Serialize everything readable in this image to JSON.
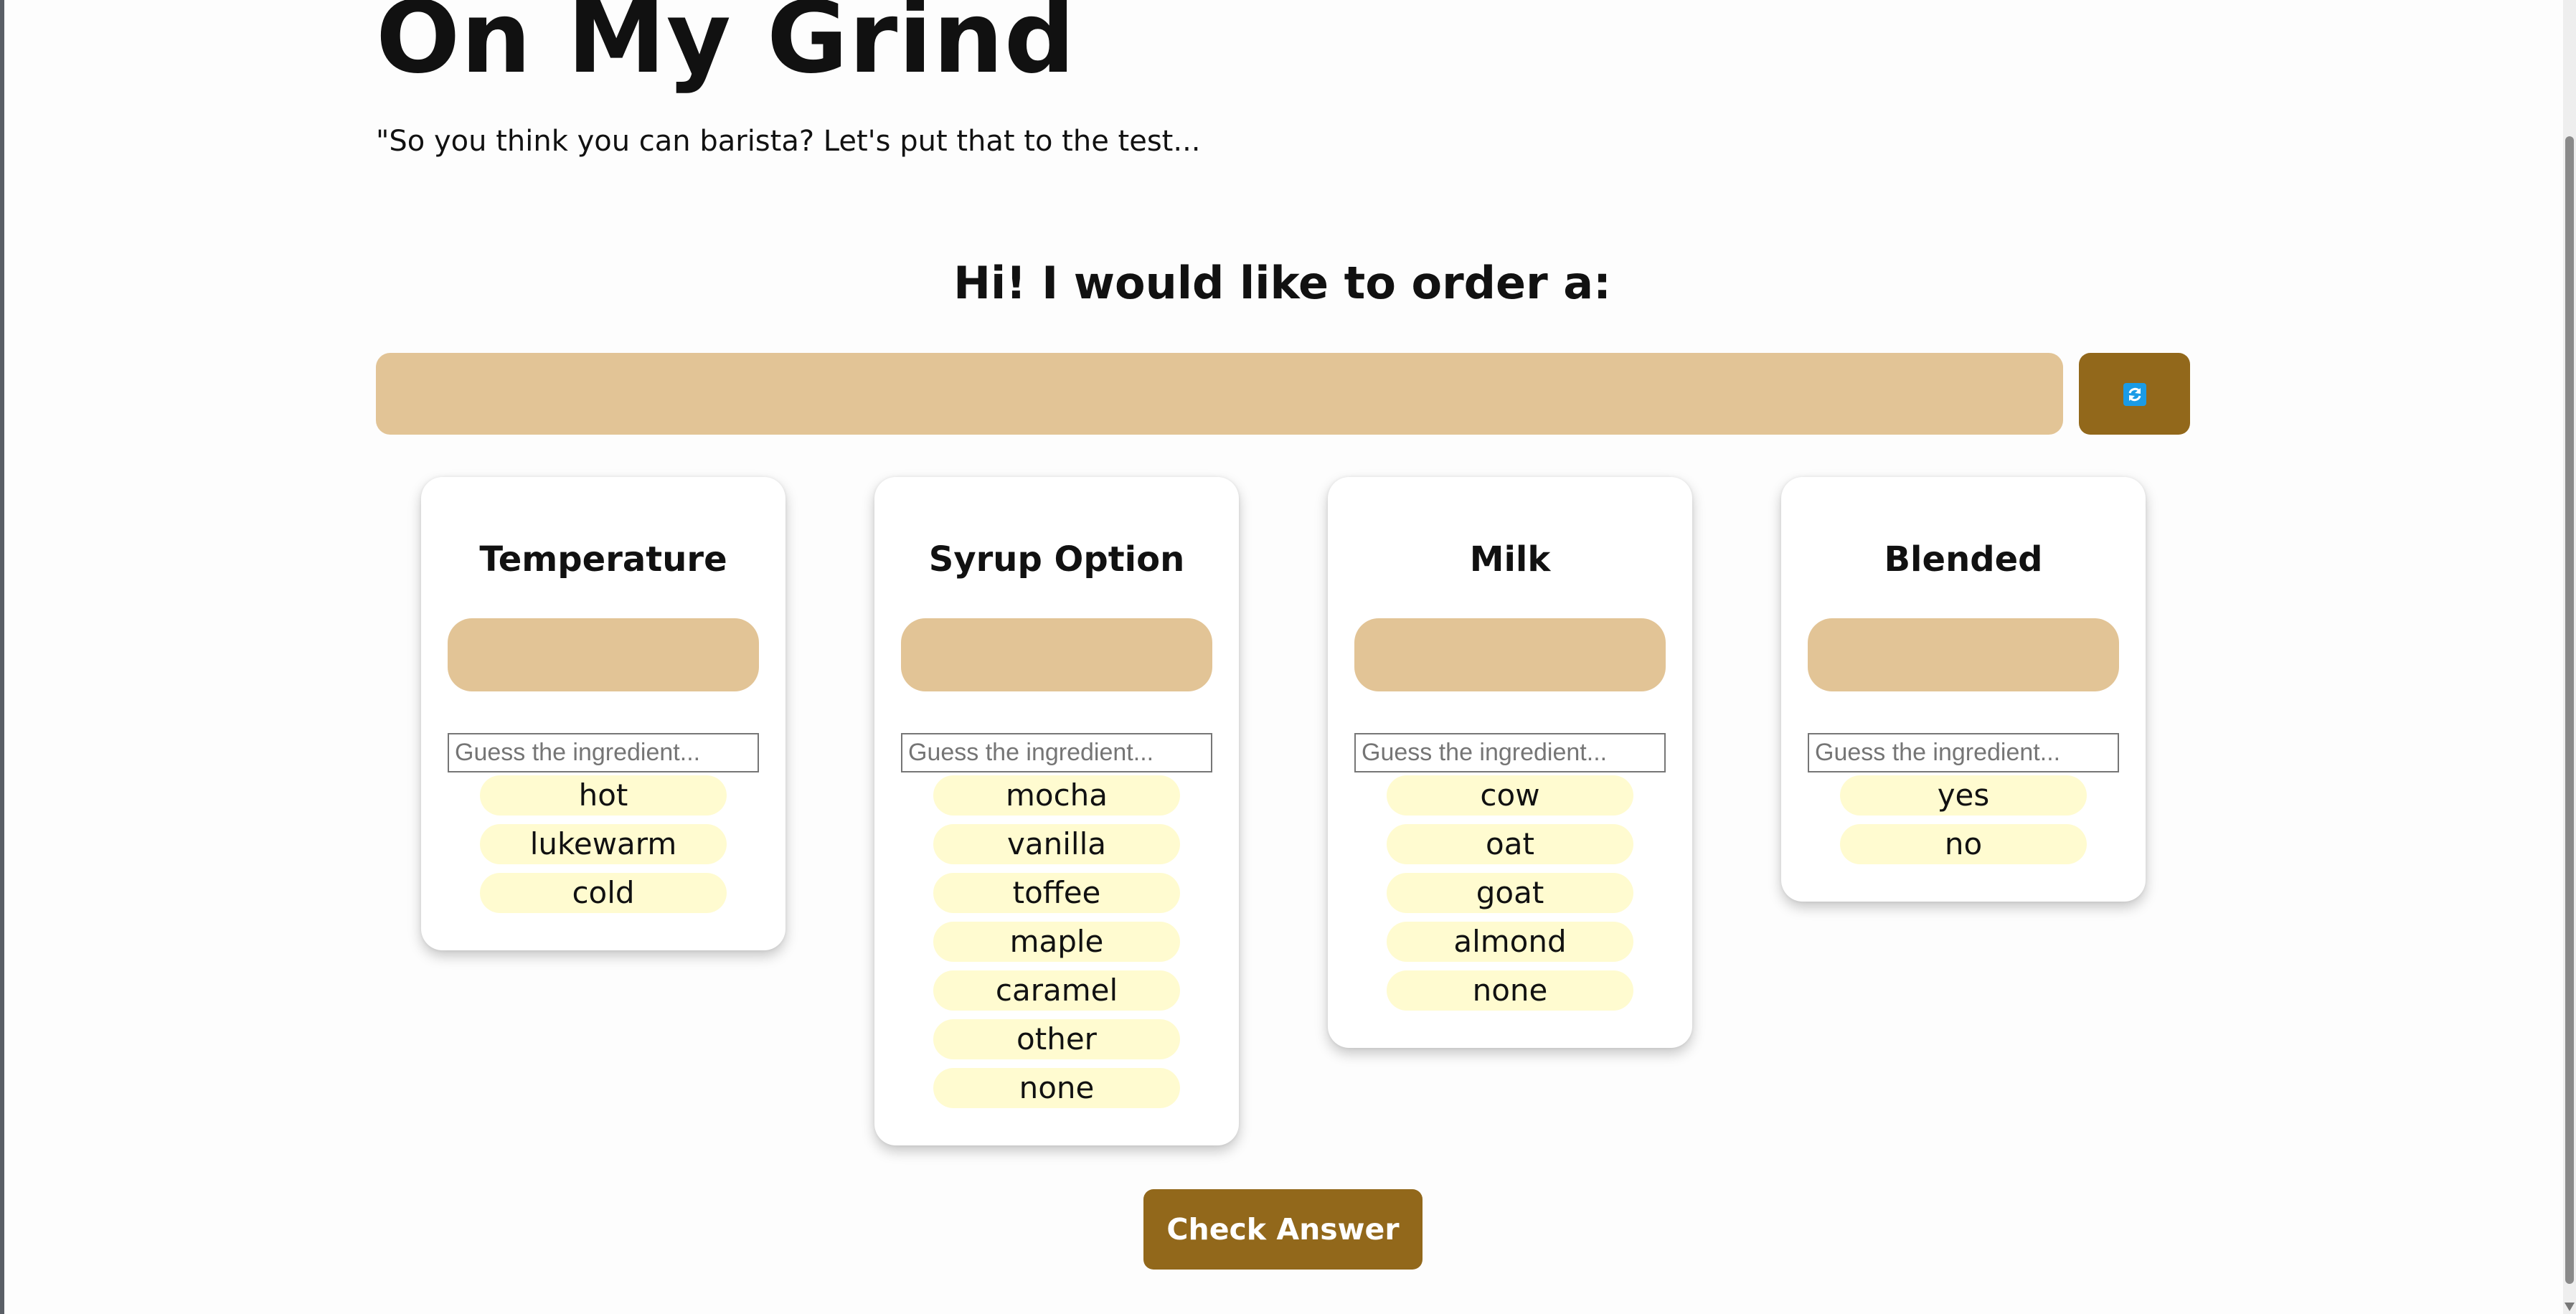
{
  "app": {
    "title": "On My Grind",
    "subtitle": "\"So you think you can barista? Let's put that to the test..."
  },
  "order": {
    "heading": "Hi! I would like to order a:",
    "current_order": "",
    "refresh_icon": "refresh-icon",
    "accent_color": "#92681b",
    "slot_color": "#e2c496",
    "option_color": "#fffbd0"
  },
  "categories": [
    {
      "title": "Temperature",
      "answer": "",
      "placeholder": "Guess the ingredient...",
      "options": [
        "hot",
        "lukewarm",
        "cold"
      ]
    },
    {
      "title": "Syrup Option",
      "answer": "",
      "placeholder": "Guess the ingredient...",
      "options": [
        "mocha",
        "vanilla",
        "toffee",
        "maple",
        "caramel",
        "other",
        "none"
      ]
    },
    {
      "title": "Milk",
      "answer": "",
      "placeholder": "Guess the ingredient...",
      "options": [
        "cow",
        "oat",
        "goat",
        "almond",
        "none"
      ]
    },
    {
      "title": "Blended",
      "answer": "",
      "placeholder": "Guess the ingredient...",
      "options": [
        "yes",
        "no"
      ]
    }
  ],
  "actions": {
    "check_label": "Check Answer"
  }
}
